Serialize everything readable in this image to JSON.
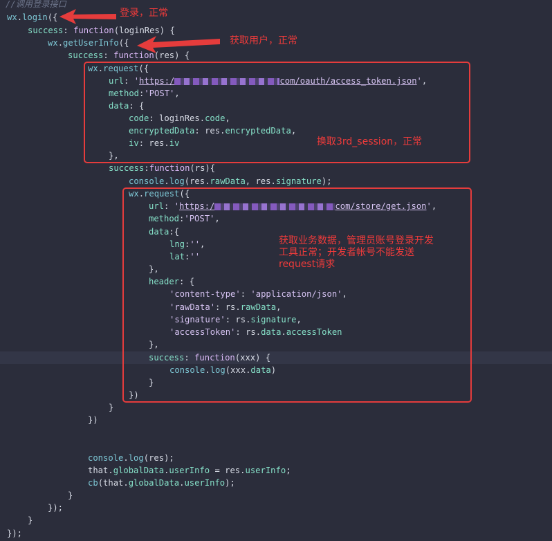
{
  "code": {
    "comment": "//调用登录接口",
    "url1_prefix": "https:/",
    "url1_suffix": "com/oauth/access_token.json",
    "url2_prefix": "https:/",
    "url2_suffix": "com/store/get.json"
  },
  "annotations": {
    "login": "登录，正常",
    "get_user_info": "获取用户，正常",
    "session": "换取3rd_session，正常",
    "business": "获取业务数据，管理员账号登录开发\n工具正常；开发者帐号不能发送\nrequest请求"
  },
  "colors": {
    "background": "#2b2d3b",
    "annotation": "#e53c3c"
  }
}
